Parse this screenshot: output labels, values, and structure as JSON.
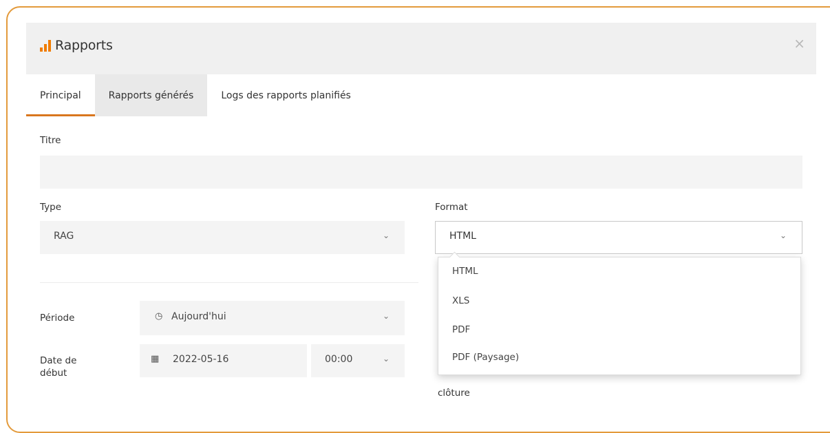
{
  "dialog": {
    "title": "Rapports",
    "close_symbol": "×",
    "icons": {
      "title": "bar-chart-icon",
      "close": "close-icon"
    },
    "accent_color": "#f07c00"
  },
  "tabs": [
    {
      "label": "Principal",
      "active": true
    },
    {
      "label": "Rapports générés",
      "active": false
    },
    {
      "label": "Logs des rapports planifiés",
      "active": false
    }
  ],
  "form": {
    "titre": {
      "label": "Titre",
      "value": ""
    },
    "type": {
      "label": "Type",
      "value": "RAG"
    },
    "format": {
      "label": "Format",
      "value": "HTML",
      "options": [
        "HTML",
        "XLS",
        "PDF",
        "PDF (Paysage)"
      ]
    },
    "periode": {
      "label": "Période",
      "value": "Aujourd'hui",
      "icon": "clock-icon"
    },
    "date_debut": {
      "label_line1": "Date de",
      "label_line2": "début",
      "date": "2022-05-16",
      "time": "00:00",
      "icon": "calendar-icon"
    },
    "date_cloture_label_partial": "clôture"
  },
  "glyphs": {
    "chevron": "⌄",
    "clock": "◷",
    "calendar": "▦"
  }
}
